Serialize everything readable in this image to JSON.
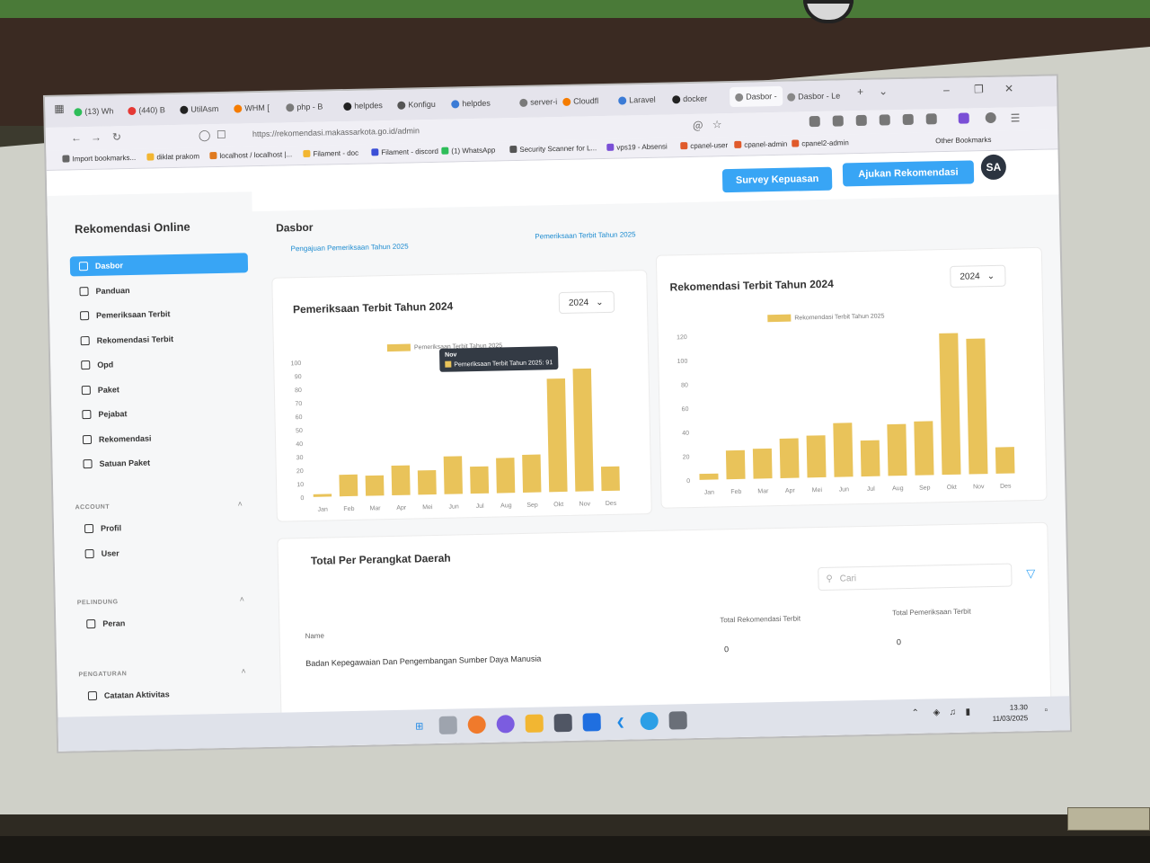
{
  "browser": {
    "tabs": [
      {
        "label": "(13) Wh",
        "color": "#2ebd59"
      },
      {
        "label": "(440) B",
        "color": "#e53935"
      },
      {
        "label": "UtilAsm",
        "color": "#222222"
      },
      {
        "label": "WHM [",
        "color": "#f57c00"
      },
      {
        "label": "php - B",
        "color": "#7a7a7a"
      },
      {
        "label": "helpdes",
        "color": "#222222"
      },
      {
        "label": "Konfigu",
        "color": "#555555"
      },
      {
        "label": "helpdes",
        "color": "#3b7bd6"
      },
      {
        "label": "server-i",
        "color": "#7a7a7a"
      },
      {
        "label": "Cloudfl",
        "color": "#f57c00"
      },
      {
        "label": "Laravel",
        "color": "#3b7bd6"
      },
      {
        "label": "docker",
        "color": "#222222"
      },
      {
        "label": "Dasbor - ",
        "color": "#888888"
      },
      {
        "label": "Dasbor - Le",
        "color": "#888888"
      }
    ],
    "url": "https://rekomendasi.makassarkota.go.id/admin",
    "bookmarks": [
      "Import bookmarks...",
      "diklat prakom",
      "localhost / localhost |...",
      "Filament - doc",
      "Filament - discord",
      "(1) WhatsApp",
      "Security Scanner for L...",
      "vps19 - Absensi",
      "cpanel-user",
      "cpanel-admin",
      "cpanel2-admin"
    ],
    "other_bookmarks": "Other Bookmarks"
  },
  "header": {
    "survey_button": "Survey Kepuasan",
    "submit_button": "Ajukan Rekomendasi",
    "avatar": "SA"
  },
  "sidebar": {
    "brand": "Rekomendasi Online",
    "items": [
      {
        "label": "Dasbor"
      },
      {
        "label": "Panduan"
      },
      {
        "label": "Pemeriksaan Terbit"
      },
      {
        "label": "Rekomendasi Terbit"
      },
      {
        "label": "Opd"
      },
      {
        "label": "Paket"
      },
      {
        "label": "Pejabat"
      },
      {
        "label": "Rekomendasi"
      },
      {
        "label": "Satuan Paket"
      }
    ],
    "groups": [
      {
        "label": "ACCOUNT",
        "items": [
          "Profil",
          "User"
        ]
      },
      {
        "label": "PELINDUNG",
        "items": [
          "Peran"
        ]
      },
      {
        "label": "PENGATURAN",
        "items": [
          "Catatan Aktivitas"
        ]
      }
    ]
  },
  "main": {
    "title": "Dasbor",
    "subtabs": [
      "Pengajuan Pemeriksaan Tahun 2025",
      "Pemeriksaan Terbit Tahun 2025"
    ]
  },
  "chart_left": {
    "card_title": "Pemeriksaan Terbit Tahun 2024",
    "year": "2024",
    "tooltip_title": "Nov",
    "tooltip_label": "Pemeriksaan Terbit Tahun 2025: 91"
  },
  "chart_right": {
    "card_title": "Rekomendasi Terbit Tahun 2024",
    "year": "2024"
  },
  "chart_data": [
    {
      "type": "bar",
      "legend": "Pemeriksaan Terbit Tahun 2025",
      "categories": [
        "Jan",
        "Feb",
        "Mar",
        "Apr",
        "Mei",
        "Jun",
        "Jul",
        "Aug",
        "Sep",
        "Okt",
        "Nov",
        "Des"
      ],
      "series": [
        {
          "name": "Pemeriksaan Terbit Tahun 2025",
          "values": [
            2,
            16,
            15,
            22,
            18,
            28,
            20,
            26,
            28,
            84,
            91,
            18
          ]
        }
      ],
      "yticks": [
        0,
        10,
        20,
        30,
        40,
        50,
        60,
        70,
        80,
        90,
        100
      ],
      "ylim": [
        0,
        100
      ],
      "color": "#e9c35a",
      "grid": false,
      "legend_position": "top"
    },
    {
      "type": "bar",
      "legend": "Rekomendasi Terbit Tahun 2025",
      "categories": [
        "Jan",
        "Feb",
        "Mar",
        "Apr",
        "Mei",
        "Jun",
        "Jul",
        "Aug",
        "Sep",
        "Okt",
        "Nov",
        "Des"
      ],
      "series": [
        {
          "name": "Rekomendasi Terbit Tahun 2025",
          "values": [
            5,
            24,
            25,
            33,
            35,
            45,
            30,
            43,
            45,
            118,
            113,
            22
          ]
        }
      ],
      "yticks": [
        0,
        20,
        40,
        60,
        80,
        100,
        120
      ],
      "ylim": [
        0,
        120
      ],
      "color": "#e9c35a",
      "grid": false,
      "legend_position": "top"
    }
  ],
  "table": {
    "title": "Total Per Perangkat Daerah",
    "search_placeholder": "Cari",
    "columns": [
      "Name",
      "Total Rekomendasi Terbit",
      "Total Pemeriksaan Terbit"
    ],
    "rows": [
      [
        "Badan Kepegawaian Dan Pengembangan Sumber Daya Manusia",
        "0",
        "0"
      ]
    ]
  },
  "taskbar": {
    "time": "13.30",
    "date": "11/03/2025"
  },
  "colors": {
    "accent": "#38a5f5",
    "bar": "#e9c35a",
    "link": "#1c8bd0"
  }
}
